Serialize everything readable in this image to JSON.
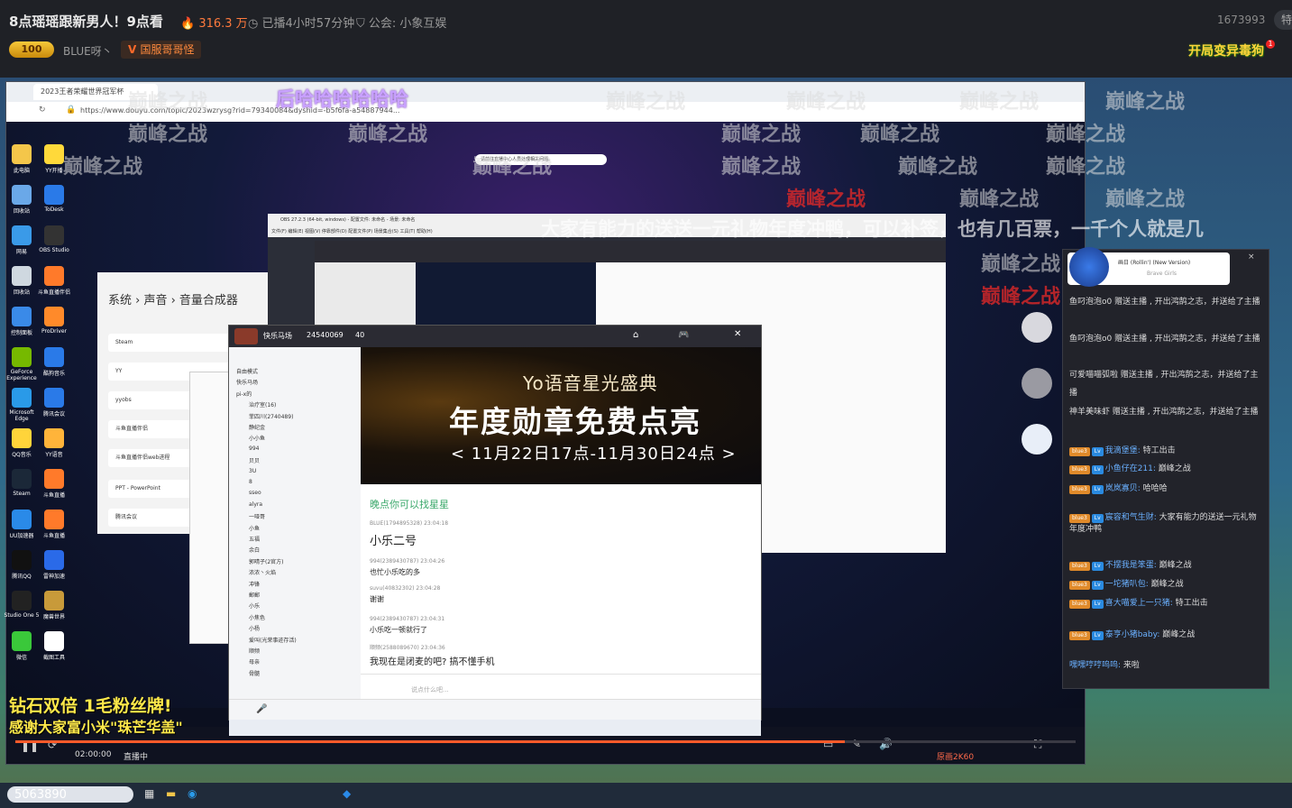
{
  "header": {
    "title": "8点瑶瑶跟新男人！9点看",
    "hot": "316.3 万",
    "played": "已播4小时57分钟",
    "guild": "公会: 小象互娱",
    "room_id": "1673993",
    "share_label": "特",
    "level_badge": "100",
    "anchor_name": "BLUE呀丶",
    "follow_tag": "国服哥哥怪",
    "promo": "开局变异毒狗",
    "promo_badge": "1"
  },
  "browser": {
    "tab_title": "2023王者荣耀世界冠军杯",
    "url": "https://www.douyu.com/topic/2023wzrysg?rid=79340084&dyshid=-b5f6fa-a54887944...",
    "notice": "请前往直播中心人员处理相关问题。",
    "time": "02:00:00",
    "live": "直播中",
    "quality": "原画2K60"
  },
  "overlays": {
    "laugh": "后哈哈哈哈哈哈",
    "ticker": "大家有能力的送送一元礼物年度冲鸭，可以补签，也有几百票，一千个人就是几",
    "promo_line1": "钻石双倍  1毛粉丝牌!",
    "promo_line2": "感谢大家富小米\"珠芒华盖\"",
    "watermark": "巅峰之战",
    "viewers": "5063890"
  },
  "desktop_icons": [
    {
      "label": "此电脑",
      "color": "#f4c64a"
    },
    {
      "label": "YY开播",
      "color": "#ffd93a"
    },
    {
      "label": "回收站",
      "color": "#6aa8e8"
    },
    {
      "label": "ToDesk",
      "color": "#2a7ae8"
    },
    {
      "label": "网易",
      "color": "#3a9ae8"
    },
    {
      "label": "OBS Studio",
      "color": "#333333"
    },
    {
      "label": "回收站",
      "color": "#cfd8e0"
    },
    {
      "label": "斗鱼直播伴侣",
      "color": "#ff7a2a"
    },
    {
      "label": "控制面板",
      "color": "#3a8ae8"
    },
    {
      "label": "ProDriver",
      "color": "#ff8a2a"
    },
    {
      "label": "GeForce Experience",
      "color": "#76b900"
    },
    {
      "label": "酷狗音乐",
      "color": "#2a7ae8"
    },
    {
      "label": "Microsoft Edge",
      "color": "#2a9ae8"
    },
    {
      "label": "腾讯会议",
      "color": "#2a7ae8"
    },
    {
      "label": "QQ音乐",
      "color": "#ffd43a"
    },
    {
      "label": "YY语音",
      "color": "#ffb43a"
    },
    {
      "label": "Steam",
      "color": "#1b2838"
    },
    {
      "label": "斗鱼直播",
      "color": "#ff7a2a"
    },
    {
      "label": "UU加速器",
      "color": "#2a8ae8"
    },
    {
      "label": "斗鱼直播",
      "color": "#ff7a2a"
    },
    {
      "label": "腾讯QQ",
      "color": "#111111"
    },
    {
      "label": "雷神加速",
      "color": "#2a6ae8"
    },
    {
      "label": "Studio One 5",
      "color": "#222222"
    },
    {
      "label": "魔兽世界",
      "color": "#c89a3a"
    },
    {
      "label": "微信",
      "color": "#3ac83a"
    },
    {
      "label": "截图工具",
      "color": "#ffffff"
    }
  ],
  "settings": {
    "breadcrumb": "系统  ›  声音  ›  音量合成器",
    "rows": [
      "Steam",
      "YY",
      "yyobs",
      "斗鱼直播伴侣",
      "斗鱼直播伴侣web进程",
      "PPT - PowerPoint",
      "腾讯会议"
    ]
  },
  "obs": {
    "title": "OBS 27.2.3 (64-bit, windows) - 配置文件: 未命名 - 场景: 未命名",
    "menu": "文件(F)  编辑(E)  视图(V)  停靠部件(D)  配置文件(P)  场景集合(S)  工具(T)  帮助(H)"
  },
  "chat": {
    "room_name": "快乐马场",
    "room_id": "24540069",
    "online": "40",
    "channel": "快乐马场",
    "members": [
      "自由模式",
      "快乐马场",
      "pi-x的",
      "治疗室(16)",
      "菲四川(2740489)",
      "静纪金",
      "小小鱼",
      "994",
      "贝贝",
      "3U",
      "8",
      "sseo",
      "alyra",
      "一哑哥",
      "小鱼",
      "五福",
      "余白",
      "郭晴子(2官方)",
      "浓浓丶火焰",
      "冲锋",
      "郵郵",
      "小乐",
      "小焦色",
      "小杨",
      "爱叫(光荣事迹存活)",
      "顺频",
      "母亲",
      "骨髓"
    ],
    "banner_line1": "Yo语音星光盛典",
    "banner_line2": "年度勋章免费点亮",
    "banner_line3": "< 11月22日17点-11月30日24点 >",
    "room_tag": "晚点你可以找星星",
    "messages": [
      {
        "user": "BLUE(1794895328)  23:04:18",
        "text": "小乐二号"
      },
      {
        "user": "994(2389430787)  23:04:26",
        "text": "也忙小乐吃的多"
      },
      {
        "user": "suvu(40832302)  23:04:28",
        "text": "谢谢"
      },
      {
        "user": "994(2389430787)  23:04:31",
        "text": "小乐吃一顿就行了"
      },
      {
        "user": "顺频(2588089670)  23:04:36",
        "text": "我现在是闭麦的吧? 搞不懂手机"
      }
    ],
    "input_placeholder": "说点什么吧..."
  },
  "side_panel": {
    "song": "画日 (Rollin') (New Version)",
    "artist": "Brave Girls",
    "close": "×",
    "gifts": [
      {
        "user": "鱼叼泡泡o0",
        "text": " 赠送主播 , 开出鸿鹄之志，并送给了主播"
      },
      {
        "user": "鱼叼泡泡o0",
        "text": " 赠送主播 , 开出鸿鹄之志，并送给了主播"
      },
      {
        "user": "可爱喵喵弧啦",
        "text": " 赠送主播 , 开出鸿鹄之志，并送给了主播"
      },
      {
        "user": "神羊美味虾",
        "text": " 赠送主播 , 开出鸿鹄之志，并送给了主播"
      }
    ],
    "chats": [
      {
        "user": "我滴堡堡: ",
        "text": "特工出击"
      },
      {
        "user": "小鱼仔在211: ",
        "text": "巅峰之战"
      },
      {
        "user": "岚岚寡贝: ",
        "text": "哈哈哈"
      },
      {
        "user": "宸容和气生财: ",
        "text": "大家有能力的送送一元礼物年度冲鸭"
      },
      {
        "user": "不摆我是笨蛋: ",
        "text": "巅峰之战"
      },
      {
        "user": "一坨猪叭包: ",
        "text": "巅峰之战"
      },
      {
        "user": "喜大喵爱上一只猪: ",
        "text": "特工出击"
      },
      {
        "user": "泰亨小猪baby: ",
        "text": "巅峰之战"
      },
      {
        "user": "嘿嘿哼哼呜呜: ",
        "text": "来啦"
      }
    ]
  },
  "colors": {
    "accent": "#ff5a2a",
    "promo": "#ffd43a",
    "hot": "#ff7a3d"
  }
}
